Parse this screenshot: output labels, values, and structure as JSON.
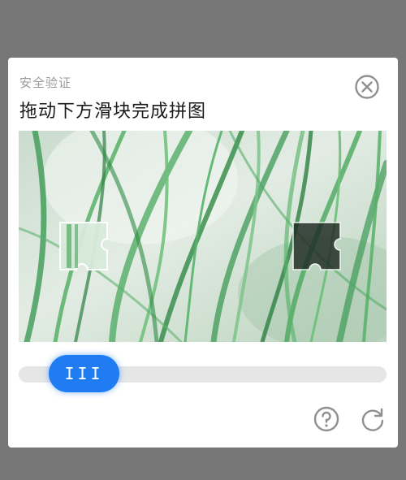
{
  "dialog": {
    "caption": "安全验证",
    "title": "拖动下方滑块完成拼图"
  },
  "icons": {
    "close": "close-circle-icon",
    "help": "question-circle-icon",
    "refresh": "refresh-icon",
    "slider_grip": "grip-lines-icon"
  },
  "slider": {
    "grip_label": "III"
  },
  "colors": {
    "overlay": "#777777",
    "accent": "#1f7cf2",
    "track": "#e6e6e6",
    "icon_gray": "#8f8f8f"
  }
}
